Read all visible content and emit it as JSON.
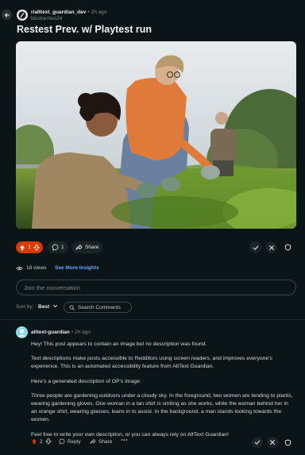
{
  "header": {
    "subreddit": "r/alttext_guardian_dev",
    "age": "2h ago",
    "username": "blooberries24"
  },
  "post": {
    "title": "Restest Prev. w/ Playtest run",
    "image_alt": "Three people gardening outdoors"
  },
  "actions": {
    "vote_count": "1",
    "comment_count": "1",
    "share_label": "Share"
  },
  "stats": {
    "views": "18 views",
    "insights_label": "See More Insights"
  },
  "join": {
    "placeholder": "Join the conversation"
  },
  "sort": {
    "label": "Sort by:",
    "value": "Best",
    "search_label": "Search Comments"
  },
  "comment": {
    "author": "alttext-guardian",
    "age": "2h ago",
    "paragraphs": [
      "Hey! This post appears to contain an image but no description was found.",
      "Text descriptions make posts accessible to Redditors using screen readers, and improves everyone's experience. This is an automated accessibility feature from AltText Guardian.",
      "Here's a generated description of OP's image:",
      "Three people are gardening outdoors under a cloudy sky. In the foreground, two women are tending to plants, wearing gardening gloves. One woman in a tan shirt is smiling as she works, while the woman behind her in an orange shirt, wearing glasses, leans in to assist. In the background, a man stands looking towards the women.",
      "Feel free to write your own description, or you can always rely on AltText Guardian!"
    ],
    "vote_count": "2",
    "reply_label": "Reply",
    "share_label": "Share"
  },
  "colors": {
    "accent": "#d93a00",
    "link": "#6ea3ff",
    "background": "#0b1416"
  }
}
